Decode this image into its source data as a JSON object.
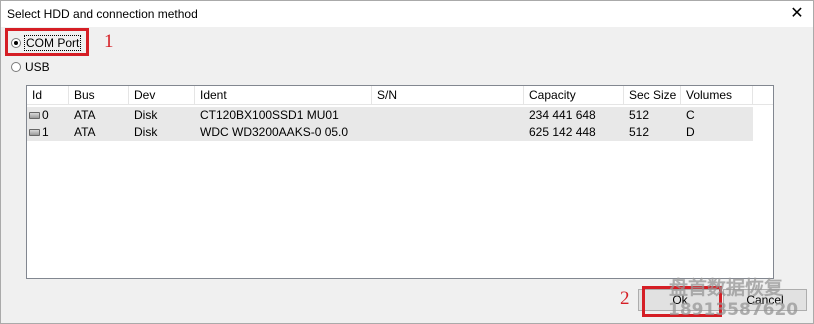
{
  "window": {
    "title": "Select HDD and connection method",
    "close_glyph": "✕"
  },
  "connection": {
    "com_port_label": "COM Port",
    "usb_label": "USB",
    "selected": "COM Port"
  },
  "annotations": {
    "marker_1": "1",
    "marker_2": "2",
    "color": "#d51e25"
  },
  "table": {
    "columns": [
      "Id",
      "Bus",
      "Dev",
      "Ident",
      "S/N",
      "Capacity",
      "Sec Size",
      "Volumes"
    ],
    "rows": [
      {
        "id": "0",
        "bus": "ATA",
        "dev": "Disk",
        "ident": "CT120BX100SSD1 MU01",
        "sn": "",
        "capacity": "234 441 648",
        "sec_size": "512",
        "volumes": "C"
      },
      {
        "id": "1",
        "bus": "ATA",
        "dev": "Disk",
        "ident": "WDC WD3200AAKS-0 05.0",
        "sn": "",
        "capacity": "625 142 448",
        "sec_size": "512",
        "volumes": "D"
      }
    ]
  },
  "buttons": {
    "ok_label": "Ok",
    "cancel_label": "Cancel"
  },
  "watermark": {
    "line1": "盘首数据恢复",
    "line2": "18913587620"
  }
}
